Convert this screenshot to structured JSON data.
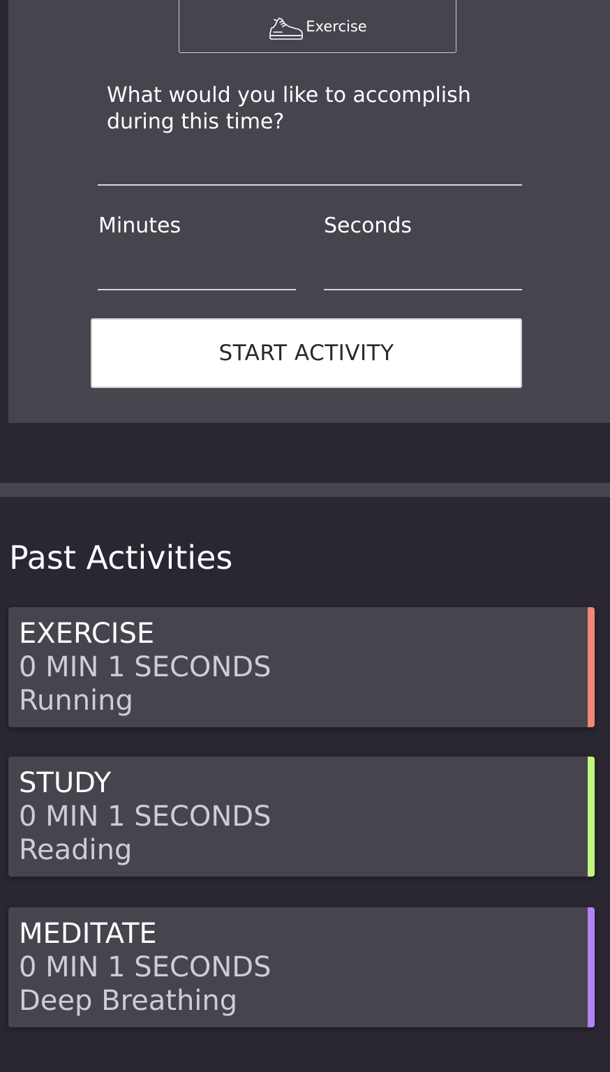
{
  "form": {
    "category_label": "Exercise",
    "category_icon": "sneaker-icon",
    "question": "What would you like to accomplish during this time?",
    "goal_value": "",
    "minutes_label": "Minutes",
    "minutes_value": "",
    "seconds_label": "Seconds",
    "seconds_value": "",
    "start_label": "START ACTIVITY"
  },
  "past": {
    "title": "Past Activities",
    "activities": [
      {
        "type": "EXERCISE",
        "duration": "0 MIN 1 SECONDS",
        "description": "Running",
        "color": "#f2867a"
      },
      {
        "type": "STUDY",
        "duration": "0 MIN 1 SECONDS",
        "description": "Reading",
        "color": "#c1f77e"
      },
      {
        "type": "MEDITATE",
        "duration": "0 MIN 1 SECONDS",
        "description": "Deep Breathing",
        "color": "#b681f5"
      }
    ]
  },
  "colors": {
    "background": "#2a2632",
    "panel": "#47444e"
  }
}
